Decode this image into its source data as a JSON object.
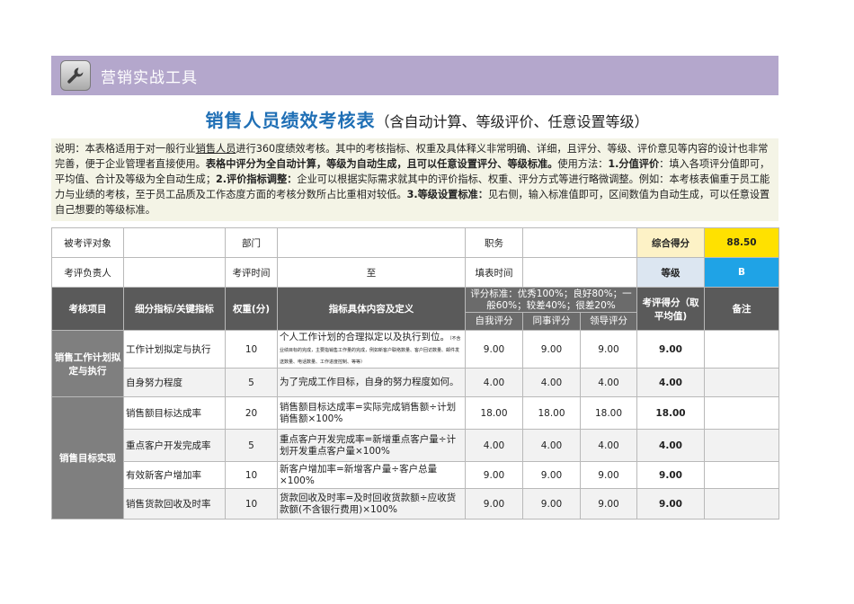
{
  "banner": {
    "title": "营销实战工具",
    "icon": "wrench-icon"
  },
  "title": {
    "main": "销售人员绩效考核表",
    "sub": "（含自动计算、等级评价、任意设置等级）"
  },
  "description": {
    "s1": "说明：本表格适用于对一般行业",
    "s1u": "销售人员",
    "s2": "进行360度绩效考核。其中的考核指标、权重及具体释义非常明确、详细，且评分、等级、评价意见等内容的设计也非常完善，便于企业管理者直接使用。",
    "b1": "表格中评分为全自动计算，等级为自动生成，且可以任意设置评分、等级标准。",
    "s3": "使用方法：",
    "b2": "1.分值评价",
    "s4": "：填入各项评分值即可，平均值、合计及等级为全自动生成；",
    "b3": "2.评价指标调整：",
    "s5": "企业可以根据实际需求就其中的评价指标、权重、评分方式等进行略微调整。例如：本考核表偏重于员工能力与业绩的考核，至于员工品质及工作态度方面的考核分数所占比重相对较低。",
    "b4": "3.等级设置标准：",
    "s6": "见右侧，输入标准值即可，区间数值为自动生成，可以任意设置自己想要的等级标准。"
  },
  "info": {
    "evaluatee_label": "被考评对象",
    "evaluatee_value": "",
    "dept_label": "部门",
    "dept_value": "",
    "position_label": "职务",
    "position_value": "",
    "total_label": "综合得分",
    "total_value": "88.50",
    "owner_label": "考评负责人",
    "owner_value": "",
    "period_label": "考评时间",
    "period_to": "至",
    "fill_date_label": "填表时间",
    "fill_date_value": "",
    "grade_label": "等级",
    "grade_value": "B"
  },
  "headers": {
    "item": "考核项目",
    "indicator": "细分指标/关键指标",
    "weight": "权重(分)",
    "definition": "指标具体内容及定义",
    "standard": "评分标准：优秀100%；良好80%；一般60%；较差40%；很差20%",
    "self": "自我评分",
    "peer": "同事评分",
    "leader": "领导评分",
    "score": "考评得分（取平均值)",
    "note": "备注"
  },
  "rows": [
    {
      "indicator": "工作计划拟定与执行",
      "weight": "10",
      "def": "个人工作计划的合理拟定以及执行到位。",
      "def_small": "（不含业绩目标的完成，主要指销售工作量的完成，例如新客户联络数量、客户回访数量、邮件发送数量、电话数量、工作进度控制、等等）",
      "self": "9.00",
      "peer": "9.00",
      "leader": "9.00",
      "score": "9.00"
    },
    {
      "indicator": "自身努力程度",
      "weight": "5",
      "def": "为了完成工作目标，自身的努力程度如何。",
      "self": "4.00",
      "peer": "4.00",
      "leader": "4.00",
      "score": "4.00"
    },
    {
      "indicator": "销售额目标达成率",
      "weight": "20",
      "def": "销售额目标达成率=实际完成销售额÷计划销售额×100%",
      "self": "18.00",
      "peer": "18.00",
      "leader": "18.00",
      "score": "18.00"
    },
    {
      "indicator": "重点客户开发完成率",
      "weight": "5",
      "def": "重点客户开发完成率=新增重点客户量÷计划开发重点客户量×100%",
      "self": "4.00",
      "peer": "4.00",
      "leader": "4.00",
      "score": "4.00"
    },
    {
      "indicator": "有效新客户增加率",
      "weight": "10",
      "def": "新客户增加率=新增客户量÷客户总量×100%",
      "self": "9.00",
      "peer": "9.00",
      "leader": "9.00",
      "score": "9.00"
    },
    {
      "indicator": "销售货款回收及时率",
      "weight": "10",
      "def": "货款回收及时率=及时回收货款额÷应收货款额(不含银行费用)×100%",
      "self": "9.00",
      "peer": "9.00",
      "leader": "9.00",
      "score": "9.00"
    }
  ],
  "categories": {
    "c1": "销售工作计划拟定与执行",
    "c2": "销售目标实现"
  }
}
